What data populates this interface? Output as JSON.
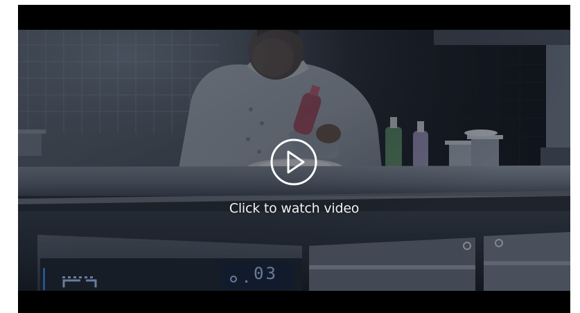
{
  "video": {
    "play_label": "Click to watch video",
    "display_readout": "03"
  },
  "icons": {
    "play": "play-icon"
  },
  "colors": {
    "overlay": "#0a1020",
    "play_ring": "#ffffff",
    "display_digits": "#9fb8e6"
  }
}
